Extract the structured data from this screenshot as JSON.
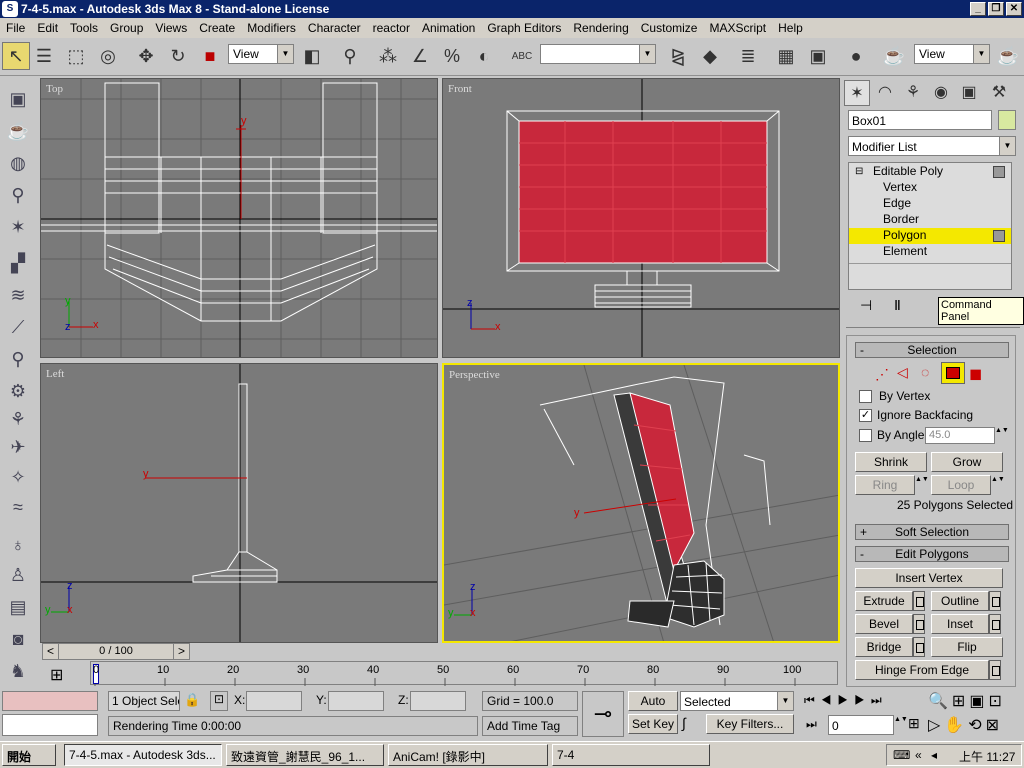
{
  "window": {
    "title": "7-4-5.max - Autodesk 3ds Max 8 - Stand-alone License",
    "app_icon": "3ds-max-icon",
    "min": "_",
    "max": "❐",
    "close": "✕"
  },
  "menu": [
    "File",
    "Edit",
    "Tools",
    "Group",
    "Views",
    "Create",
    "Modifiers",
    "Character",
    "reactor",
    "Animation",
    "Graph Editors",
    "Rendering",
    "Customize",
    "MAXScript",
    "Help"
  ],
  "toolbar": {
    "ref_coord": "View",
    "named_sel": "",
    "view_right": "View",
    "abc": "ABC"
  },
  "viewports": {
    "top": "Top",
    "front": "Front",
    "left": "Left",
    "perspective": "Perspective"
  },
  "axes": {
    "x": "x",
    "y": "y",
    "z": "z"
  },
  "cmd": {
    "object_name": "Box01",
    "modifier_list": "Modifier List",
    "stack": {
      "root": "Editable Poly",
      "items": [
        "Vertex",
        "Edge",
        "Border",
        "Polygon",
        "Element"
      ],
      "selected": "Polygon"
    },
    "tooltip": "Command Panel",
    "selection": {
      "header": "Selection",
      "by_vertex": "By Vertex",
      "ignore_backfacing": "Ignore Backfacing",
      "by_angle": "By Angle:",
      "angle_value": "45.0",
      "shrink": "Shrink",
      "grow": "Grow",
      "ring": "Ring",
      "loop": "Loop",
      "status": "25 Polygons Selected"
    },
    "soft_selection": {
      "header": "Soft Selection",
      "sign": "+"
    },
    "edit_polygons": {
      "header": "Edit Polygons",
      "sign": "-",
      "insert_vertex": "Insert Vertex",
      "extrude": "Extrude",
      "outline": "Outline",
      "bevel": "Bevel",
      "inset": "Inset",
      "bridge": "Bridge",
      "flip": "Flip",
      "hinge": "Hinge From Edge"
    }
  },
  "timeline": {
    "frame": "0 / 100",
    "prev": "<",
    "next": ">",
    "ticks": [
      "0",
      "10",
      "20",
      "30",
      "40",
      "50",
      "60",
      "70",
      "80",
      "90",
      "100"
    ]
  },
  "status": {
    "selection": "1 Object Sele",
    "x_label": "X:",
    "y_label": "Y:",
    "z_label": "Z:",
    "grid": "Grid = 100.0",
    "auto_key": "Auto Key",
    "set_key": "Set Key",
    "key_mode": "Selected",
    "key_filters": "Key Filters...",
    "frame": "0",
    "render_time": "Rendering Time  0:00:00",
    "add_time_tag": "Add Time Tag"
  },
  "taskbar": {
    "start": "開始",
    "tasks": [
      "7-4-5.max - Autodesk 3ds...",
      "致遠資管_謝慧民_96_1...",
      "AniCam! [錄影中]",
      "7-4"
    ],
    "clock": "上午 11:27"
  },
  "colors": {
    "selected_poly": "#c8283c",
    "viewport_bg": "#7a7a7a",
    "active_border": "#f4e800",
    "stack_highlight": "#f4e800"
  }
}
